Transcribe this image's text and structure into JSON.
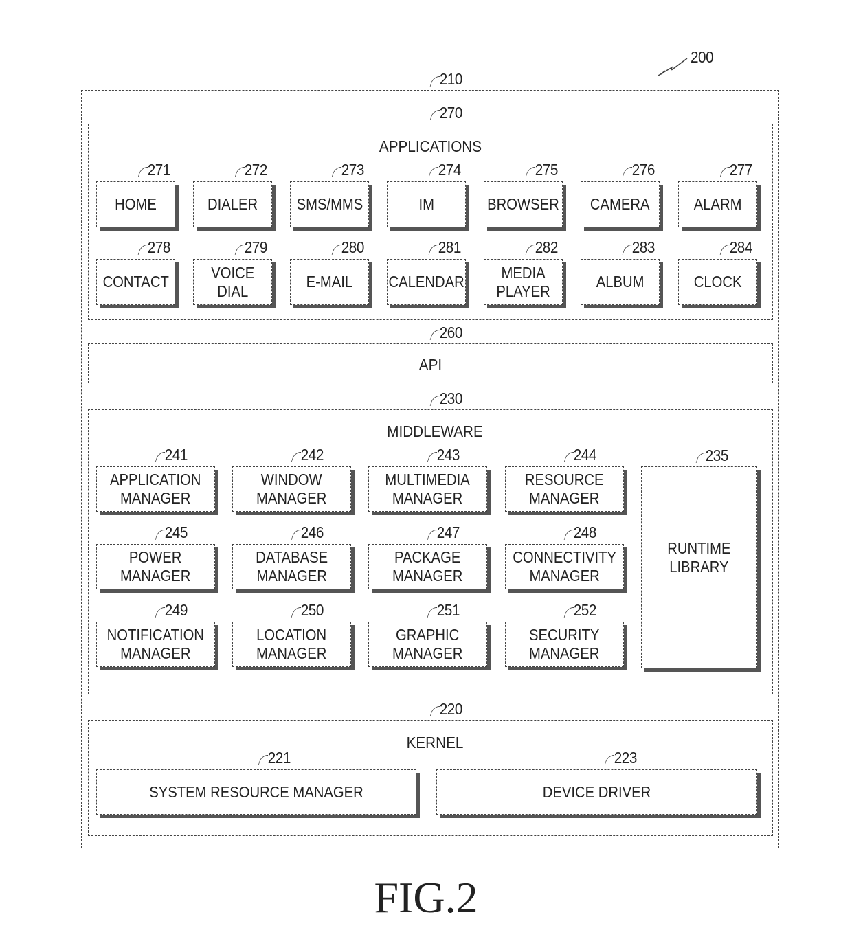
{
  "figure": {
    "ref": "200",
    "caption": "FIG.2",
    "outer_ref": "210"
  },
  "applications": {
    "ref": "270",
    "title": "APPLICATIONS",
    "items": [
      {
        "ref": "271",
        "label": "HOME"
      },
      {
        "ref": "272",
        "label": "DIALER"
      },
      {
        "ref": "273",
        "label": "SMS/MMS"
      },
      {
        "ref": "274",
        "label": "IM"
      },
      {
        "ref": "275",
        "label": "BROWSER"
      },
      {
        "ref": "276",
        "label": "CAMERA"
      },
      {
        "ref": "277",
        "label": "ALARM"
      },
      {
        "ref": "278",
        "label": "CONTACT"
      },
      {
        "ref": "279",
        "label": "VOICE\nDIAL"
      },
      {
        "ref": "280",
        "label": "E-MAIL"
      },
      {
        "ref": "281",
        "label": "CALENDAR"
      },
      {
        "ref": "282",
        "label": "MEDIA\nPLAYER"
      },
      {
        "ref": "283",
        "label": "ALBUM"
      },
      {
        "ref": "284",
        "label": "CLOCK"
      }
    ]
  },
  "api": {
    "ref": "260",
    "title": "API"
  },
  "middleware": {
    "ref": "230",
    "title": "MIDDLEWARE",
    "items": [
      {
        "ref": "241",
        "label": "APPLICATION\nMANAGER"
      },
      {
        "ref": "242",
        "label": "WINDOW\nMANAGER"
      },
      {
        "ref": "243",
        "label": "MULTIMEDIA\nMANAGER"
      },
      {
        "ref": "244",
        "label": "RESOURCE\nMANAGER"
      },
      {
        "ref": "245",
        "label": "POWER\nMANAGER"
      },
      {
        "ref": "246",
        "label": "DATABASE\nMANAGER"
      },
      {
        "ref": "247",
        "label": "PACKAGE\nMANAGER"
      },
      {
        "ref": "248",
        "label": "CONNECTIVITY\nMANAGER"
      },
      {
        "ref": "249",
        "label": "NOTIFICATION\nMANAGER"
      },
      {
        "ref": "250",
        "label": "LOCATION\nMANAGER"
      },
      {
        "ref": "251",
        "label": "GRAPHIC\nMANAGER"
      },
      {
        "ref": "252",
        "label": "SECURITY\nMANAGER"
      }
    ],
    "runtime": {
      "ref": "235",
      "label": "RUNTIME\nLIBRARY"
    }
  },
  "kernel": {
    "ref": "220",
    "title": "KERNEL",
    "items": [
      {
        "ref": "221",
        "label": "SYSTEM RESOURCE MANAGER"
      },
      {
        "ref": "223",
        "label": "DEVICE DRIVER"
      }
    ]
  }
}
